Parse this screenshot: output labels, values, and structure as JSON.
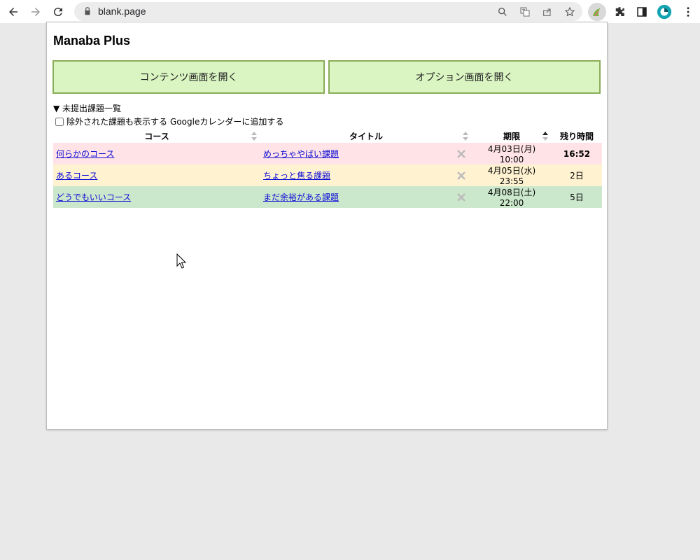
{
  "browser": {
    "url": "blank.page"
  },
  "popup": {
    "title": "Manaba Plus",
    "buttons": {
      "open_contents": "コンテンツ画面を開く",
      "open_options": "オプション画面を開く"
    },
    "section_summary": "▼ 未提出課題一覧",
    "show_excluded_label": "除外された課題も表示する",
    "google_calendar_link": "Googleカレンダーに追加する",
    "table": {
      "headers": {
        "course": "コース",
        "title": "タイトル",
        "deadline": "期限",
        "remaining": "残り時間"
      },
      "rows": [
        {
          "course": "何らかのコース",
          "title": "めっちゃやばい課題",
          "deadline": "4月03日(月) 10:00",
          "remaining": "16:52",
          "status": "urgent"
        },
        {
          "course": "あるコース",
          "title": "ちょっと焦る課題",
          "deadline": "4月05日(水) 23:55",
          "remaining": "2日",
          "status": "soon"
        },
        {
          "course": "どうでもいいコース",
          "title": "まだ余裕がある課題",
          "deadline": "4月08日(土) 22:00",
          "remaining": "5日",
          "status": "later"
        }
      ]
    }
  },
  "colors": {
    "button_bg": "#daf5c2",
    "button_border": "#8aad5a",
    "row_urgent": "#ffe3e6",
    "row_soon": "#fff2d1",
    "row_later": "#cce8cc"
  }
}
